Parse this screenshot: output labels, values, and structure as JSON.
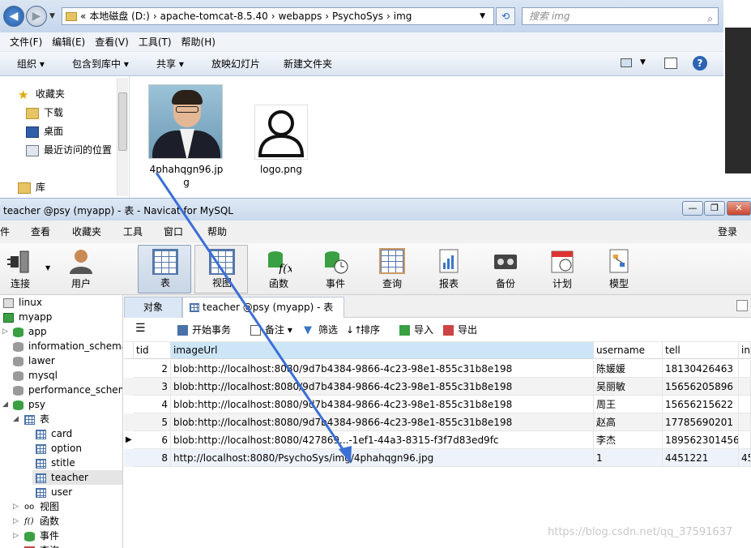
{
  "explorer": {
    "path": [
      "«",
      "本地磁盘 (D:)",
      "›",
      "apache-tomcat-8.5.40",
      "›",
      "webapps",
      "›",
      "PsychoSys",
      "›",
      "img"
    ],
    "search_placeholder": "搜索 img",
    "menu": [
      "文件(F)",
      "编辑(E)",
      "查看(V)",
      "工具(T)",
      "帮助(H)"
    ],
    "toolbar": [
      "组织 ▾",
      "包含到库中 ▾",
      "共享 ▾",
      "放映幻灯片",
      "新建文件夹"
    ],
    "nav": [
      {
        "label": "收藏夹",
        "icon": "star-icon"
      },
      {
        "label": "下载",
        "icon": "download-folder-icon"
      },
      {
        "label": "桌面",
        "icon": "desktop-icon"
      },
      {
        "label": "最近访问的位置",
        "icon": "recent-places-icon"
      },
      {
        "label": "库",
        "icon": "library-icon"
      }
    ],
    "files": [
      {
        "name_line1": "4phahqgn96.jp",
        "name_line2": "g",
        "icon": "photo-thumbnail"
      },
      {
        "name_line1": "logo.png",
        "name_line2": "",
        "icon": "user-silhouette-icon"
      }
    ]
  },
  "navicat": {
    "title": "teacher @psy (myapp) - 表 - Navicat for MySQL",
    "menu": [
      "件",
      "查看",
      "收藏夹",
      "工具",
      "窗口",
      "帮助"
    ],
    "login": "登录",
    "tools": [
      {
        "label": "连接",
        "icon": "plug-icon"
      },
      {
        "label": "用户",
        "icon": "user-icon"
      },
      {
        "label": "表",
        "icon": "table-icon"
      },
      {
        "label": "视图",
        "icon": "view-glasses-icon"
      },
      {
        "label": "函数",
        "icon": "function-icon"
      },
      {
        "label": "事件",
        "icon": "event-clock-icon"
      },
      {
        "label": "查询",
        "icon": "query-grid-icon"
      },
      {
        "label": "报表",
        "icon": "report-icon"
      },
      {
        "label": "备份",
        "icon": "backup-tape-icon"
      },
      {
        "label": "计划",
        "icon": "calendar-icon"
      },
      {
        "label": "模型",
        "icon": "model-icon"
      }
    ],
    "tree": [
      {
        "label": "linux",
        "icon": "connection-icon"
      },
      {
        "label": "myapp",
        "icon": "connection-icon"
      },
      {
        "label": "app",
        "icon": "database-icon"
      },
      {
        "label": "information_schema",
        "icon": "database-icon"
      },
      {
        "label": "lawer",
        "icon": "database-icon"
      },
      {
        "label": "mysql",
        "icon": "database-icon"
      },
      {
        "label": "performance_schema",
        "icon": "database-icon"
      },
      {
        "label": "psy",
        "icon": "database-icon"
      },
      {
        "label": "表",
        "icon": "tables-folder-icon"
      },
      {
        "label": "card",
        "icon": "table-icon"
      },
      {
        "label": "option",
        "icon": "table-icon"
      },
      {
        "label": "stitle",
        "icon": "table-icon"
      },
      {
        "label": "teacher",
        "icon": "table-icon"
      },
      {
        "label": "user",
        "icon": "table-icon"
      },
      {
        "label": "视图",
        "icon": "view-glasses-icon"
      },
      {
        "label": "函数",
        "icon": "function-icon"
      },
      {
        "label": "事件",
        "icon": "event-clock-icon"
      },
      {
        "label": "查询",
        "icon": "query-grid-icon"
      }
    ],
    "tabs": [
      "对象",
      "teacher @psy (myapp) - 表"
    ],
    "table_toolbar": [
      "开始事务",
      "备注 ▾",
      "筛选",
      "排序",
      "导入",
      "导出"
    ],
    "columns": [
      "tid",
      "imageUrl",
      "username",
      "tell",
      "in"
    ],
    "rows": [
      [
        "2",
        "blob:http://localhost:8080/9d7b4384-9866-4c23-98e1-855c31b8e198",
        "陈媛媛",
        "18130426463",
        ""
      ],
      [
        "3",
        "blob:http://localhost:8080/9d7b4384-9866-4c23-98e1-855c31b8e198",
        "吴丽敏",
        "15656205896",
        ""
      ],
      [
        "4",
        "blob:http://localhost:8080/9d7b4384-9866-4c23-98e1-855c31b8e198",
        "周王",
        "15656215622",
        ""
      ],
      [
        "5",
        "blob:http://localhost:8080/9d7b4384-9866-4c23-98e1-855c31b8e198",
        "赵高",
        "17785690201",
        ""
      ],
      [
        "6",
        "blob:http://localhost:8080/427869...-1ef1-44a3-8315-f3f7d83ed9fc",
        "李杰",
        "189562301456",
        ""
      ],
      [
        "8",
        "http://localhost:8080/PsychoSys/img/4phahqgn96.jpg",
        "1",
        "4451221",
        "45"
      ]
    ]
  },
  "watermark": "https://blog.csdn.net/qq_37591637",
  "colors": {
    "accent_arrow": "#3b6fd6",
    "header_selected": "#cde6f7"
  }
}
